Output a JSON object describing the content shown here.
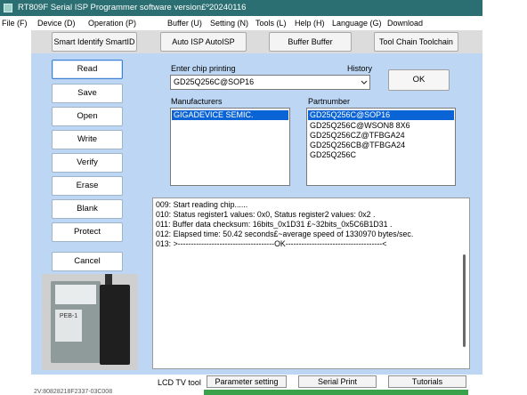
{
  "window": {
    "title": "RT809F Serial ISP Programmer software version£º20240116"
  },
  "menu": [
    "File (F)",
    "Device (D)",
    "Operation (P)",
    "Buffer (U)",
    "Setting (N)",
    "Tools (L)",
    "Help (H)",
    "Language (G)",
    "Download"
  ],
  "toolbar": {
    "smart_identify": "Smart Identify SmartID",
    "auto_isp": "Auto ISP AutoISP",
    "buffer": "Buffer Buffer",
    "tool_chain": "Tool Chain Toolchain"
  },
  "actions": {
    "read": "Read",
    "save": "Save",
    "open": "Open",
    "write": "Write",
    "verify": "Verify",
    "erase": "Erase",
    "blank": "Blank",
    "protect": "Protect",
    "cancel": "Cancel"
  },
  "device_photo": {
    "label": "PEB-1"
  },
  "chip": {
    "enter_label": "Enter chip printing",
    "history_label": "History",
    "value": "GD25Q256C@SOP16",
    "ok": "OK"
  },
  "manufacturers": {
    "label": "Manufacturers",
    "items": [
      "GIGADEVICE SEMIC."
    ],
    "selected_index": 0
  },
  "partnumbers": {
    "label": "Partnumber",
    "items": [
      "GD25Q256C@SOP16",
      "GD25Q256C@WSON8 8X6",
      "GD25Q256CZ@TFBGA24",
      "GD25Q256CB@TFBGA24",
      "GD25Q256C"
    ],
    "selected_index": 0
  },
  "log": [
    "009:  Start reading chip......",
    "010:  Status register1 values: 0x0, Status register2 values: 0x2 .",
    "011:  Buffer data checksum: 16bits_0x1D31 £~32bits_0x5C6B1D31 .",
    "012:  Elapsed time: 50.42 seconds£~average speed of 1330970 bytes/sec.",
    "013:  >-------------------------------------OK-------------------------------------<"
  ],
  "bottom": {
    "lcd_tool": "LCD TV tool",
    "parameter_setting": "Parameter setting",
    "serial_print": "Serial Print",
    "tutorials": "Tutorials",
    "status_text": "2V:80828218F2337-03C008"
  },
  "colors": {
    "titlebar": "#2b6f73",
    "panel": "#bcd6f3",
    "selection": "#0a64d6",
    "progress": "#3aa24b"
  }
}
